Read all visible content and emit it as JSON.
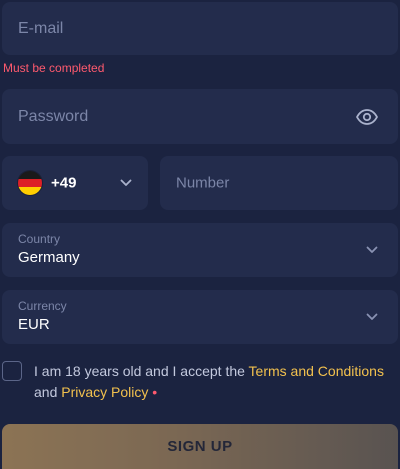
{
  "email": {
    "placeholder": "E-mail",
    "error": "Must be completed"
  },
  "password": {
    "placeholder": "Password"
  },
  "phone": {
    "country_code": "+49",
    "flag": "germany-flag-icon",
    "placeholder": "Number"
  },
  "country": {
    "label": "Country",
    "value": "Germany"
  },
  "currency": {
    "label": "Currency",
    "value": "EUR"
  },
  "terms": {
    "text_before": "I am 18 years old and I accept the ",
    "terms_link": "Terms and Conditions",
    "text_and": " and ",
    "privacy_link": "Privacy Policy",
    "required_marker": " •",
    "checked": false
  },
  "signup": {
    "label": "SIGN UP",
    "enabled": false
  },
  "colors": {
    "background": "#1b2340",
    "field": "#232c4c",
    "placeholder": "#7c86a8",
    "error": "#ff5a6e",
    "link": "#f2c14e",
    "button_gradient_start": "#e8b565"
  }
}
